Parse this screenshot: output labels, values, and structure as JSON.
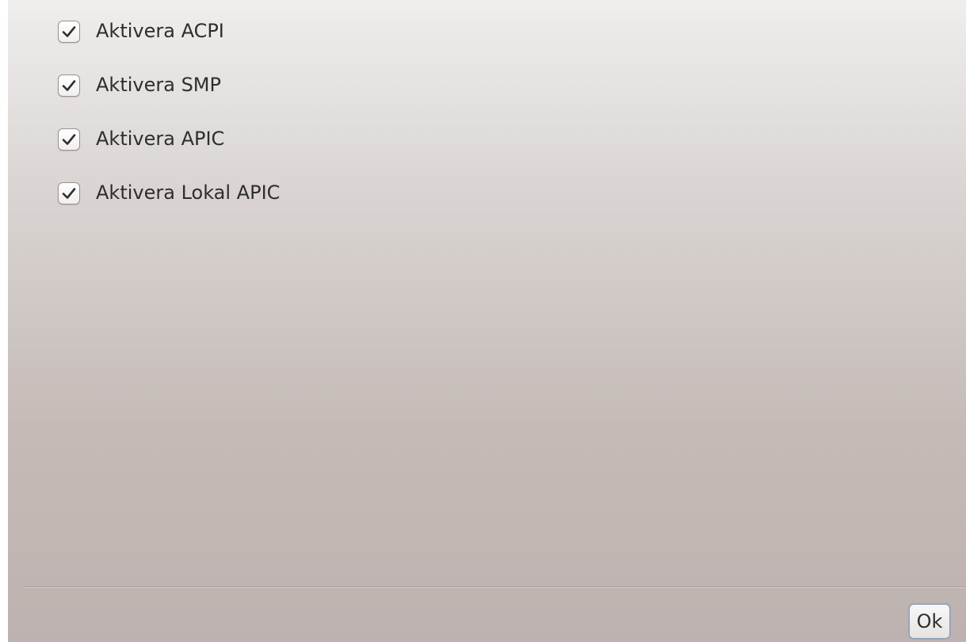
{
  "options": [
    {
      "label": "Aktivera ACPI",
      "checked": true
    },
    {
      "label": "Aktivera SMP",
      "checked": true
    },
    {
      "label": "Aktivera APIC",
      "checked": true
    },
    {
      "label": "Aktivera Lokal APIC",
      "checked": true
    }
  ],
  "footer": {
    "ok_label": "Ok"
  },
  "icons": {
    "checkbox_mark": "checkmark-icon"
  }
}
